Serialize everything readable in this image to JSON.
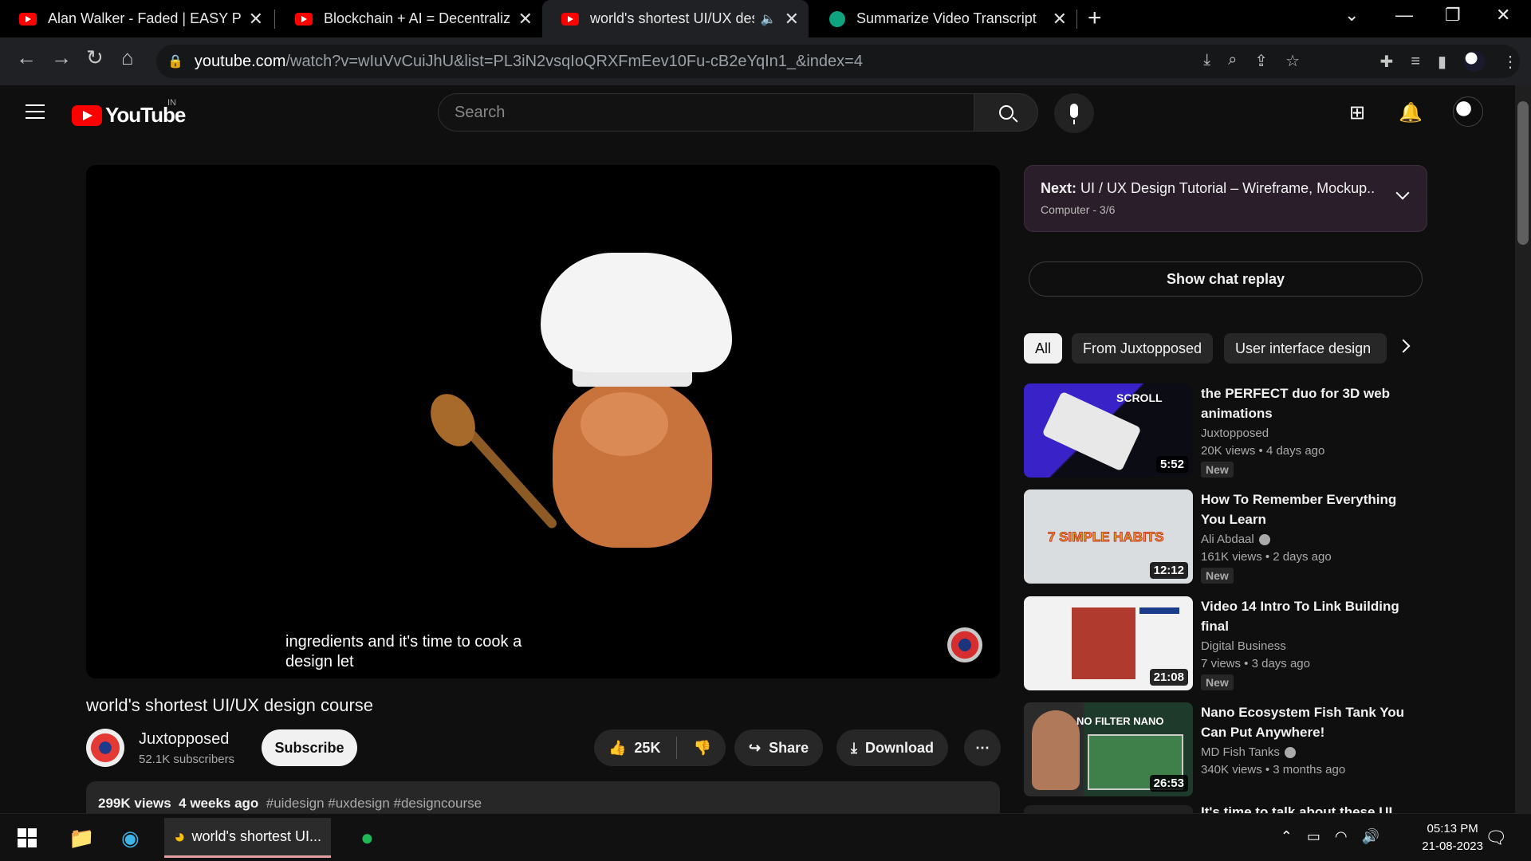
{
  "browser": {
    "tabs": [
      {
        "title": "Alan Walker - Faded | EASY Piano",
        "icon": "youtube-favicon"
      },
      {
        "title": "Blockchain + AI = Decentralized A",
        "icon": "youtube-favicon"
      },
      {
        "title": "world's shortest UI/UX design",
        "icon": "youtube-favicon",
        "active": true
      },
      {
        "title": "Summarize Video Transcript",
        "icon": "chatgpt-favicon"
      }
    ],
    "url_host": "youtube.com",
    "url_path": "/watch?v=wIuVvCuiJhU&list=PL3iN2vsqIoQRXFmEev10Fu-cB2eYqIn1_&index=4"
  },
  "masthead": {
    "logo_text": "YouTube",
    "region": "IN",
    "search_placeholder": "Search"
  },
  "video": {
    "caption_line1": "ingredients and it's time to cook a",
    "caption_line2": "design let",
    "title": "world's shortest UI/UX design course",
    "channel": "Juxtopposed",
    "subscribers": "52.1K subscribers",
    "subscribe_label": "Subscribe",
    "likes": "25K",
    "share_label": "Share",
    "download_label": "Download",
    "views": "299K views",
    "age": "4 weeks ago",
    "tags": "#uidesign #uxdesign #designcourse"
  },
  "playlist_next": {
    "prefix": "Next:",
    "title": "UI / UX Design Tutorial – Wireframe, Mockup...",
    "sub": "Computer - 3/6"
  },
  "chat_replay_label": "Show chat replay",
  "chips": [
    "All",
    "From Juxtopposed",
    "User interface design"
  ],
  "recommendations": [
    {
      "title": "the PERFECT duo for 3D web animations",
      "channel": "Juxtopposed",
      "meta": "20K views • 4 days ago",
      "duration": "5:52",
      "badge": "New",
      "thumb_color": "#2d1a8a",
      "thumb_text": "SCROLL",
      "verified": false
    },
    {
      "title": "How To Remember Everything You Learn",
      "channel": "Ali Abdaal",
      "meta": "161K views • 2 days ago",
      "duration": "12:12",
      "badge": "New",
      "thumb_color": "#d9dde0",
      "thumb_text": "7 SIMPLE HABITS",
      "verified": true
    },
    {
      "title": "Video 14 Intro To Link Building final",
      "channel": "Digital Business",
      "meta": "7 views • 3 days ago",
      "duration": "21:08",
      "badge": "New",
      "thumb_color": "#f2f2f2",
      "thumb_text": "",
      "verified": false
    },
    {
      "title": "Nano Ecosystem Fish Tank You Can Put Anywhere!",
      "channel": "MD Fish Tanks",
      "meta": "340K views • 3 months ago",
      "duration": "26:53",
      "badge": "",
      "thumb_color": "#1e3a2a",
      "thumb_text": "NO FILTER NANO",
      "verified": true
    },
    {
      "title": "It's time to talk about these UI",
      "channel": "",
      "meta": "",
      "duration": "",
      "badge": "",
      "thumb_color": "#202020",
      "thumb_text": "",
      "verified": false
    }
  ],
  "taskbar": {
    "chrome_window_title": "world's shortest UI...",
    "time": "05:13 PM",
    "date": "21-08-2023"
  }
}
